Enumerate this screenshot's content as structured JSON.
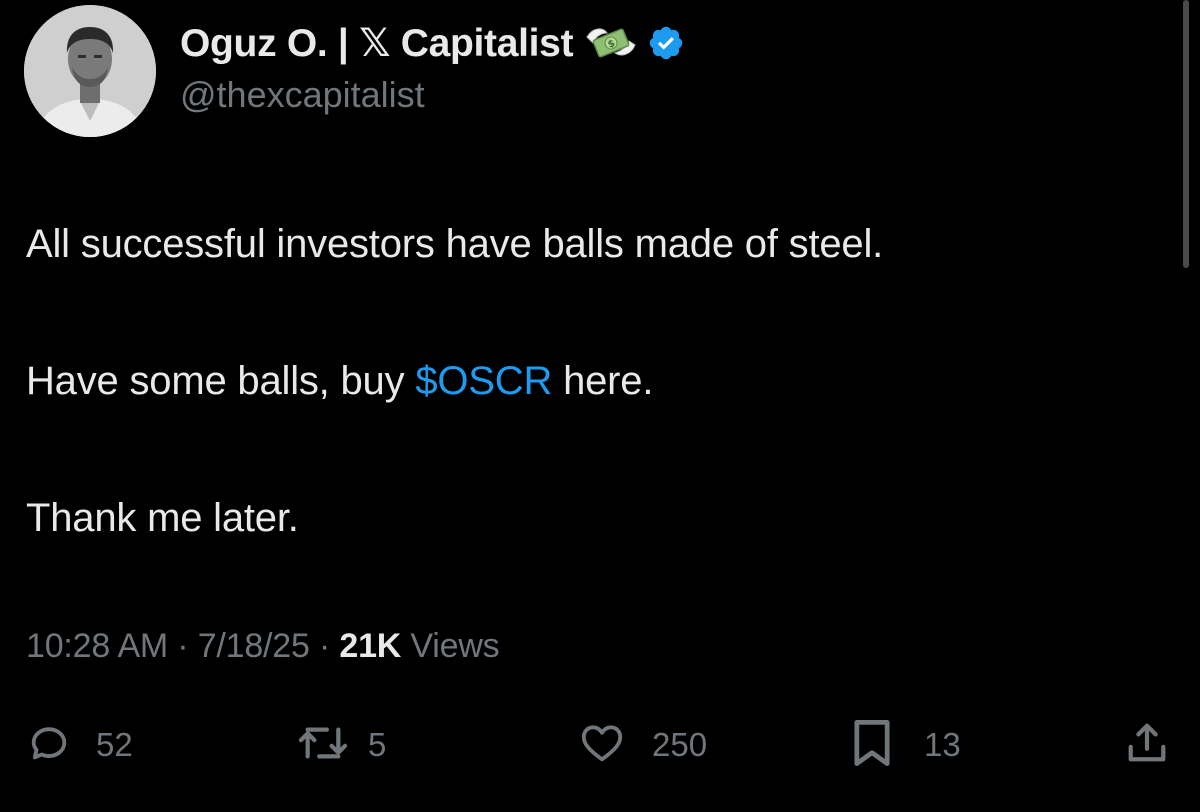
{
  "author": {
    "display_name": "Oguz O. | 𝕏 Capitalist",
    "handle": "@thexcapitalist",
    "badge_icon": "money-with-wings-icon",
    "verified_icon": "verified-badge-icon",
    "verified_color": "#1d9bf0"
  },
  "tweet": {
    "line1": "All successful investors have balls made of steel.",
    "line2_pre": "Have some balls, buy ",
    "line2_cashtag": "$OSCR",
    "line2_post": " here.",
    "line3": "Thank me later."
  },
  "meta": {
    "time": "10:28 AM",
    "sep1": " · ",
    "date": "7/18/25",
    "sep2": " · ",
    "views_count": "21K",
    "views_label": " Views"
  },
  "actions": {
    "replies": "52",
    "reposts": "5",
    "likes": "250",
    "bookmarks": "13"
  },
  "colors": {
    "background": "#000000",
    "text": "#e7e9ea",
    "secondary": "#71767b",
    "accent": "#1d9bf0"
  }
}
